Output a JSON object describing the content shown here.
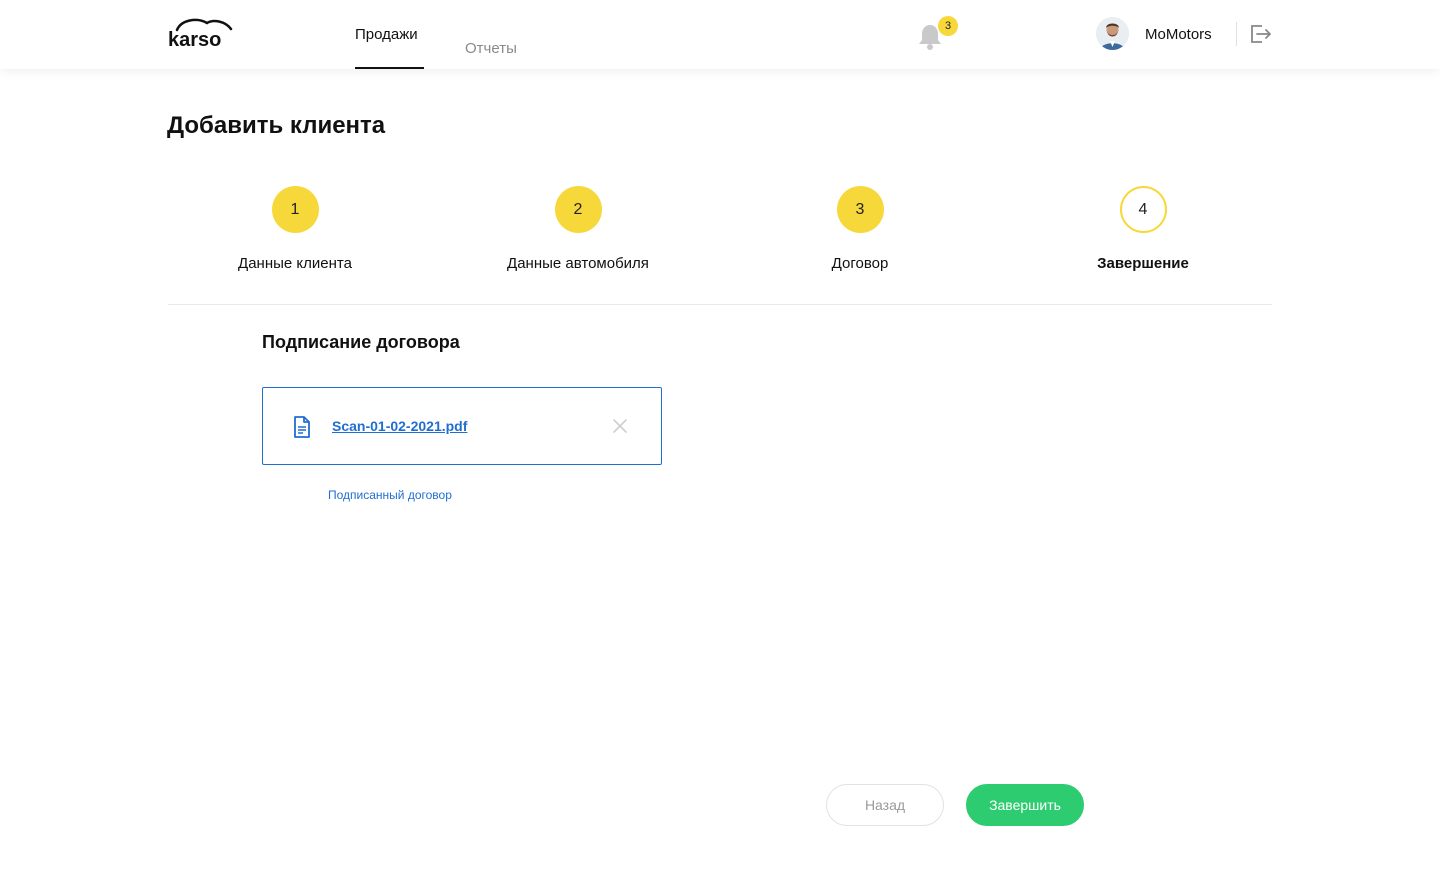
{
  "header": {
    "logo_text": "karso",
    "nav": [
      {
        "label": "Продажи",
        "active": true
      },
      {
        "label": "Отчеты",
        "active": false
      }
    ],
    "notifications_count": "3",
    "username": "MoMotors"
  },
  "page_title": "Добавить клиента",
  "steps": [
    {
      "number": "1",
      "label": "Данные клиента",
      "state": "done"
    },
    {
      "number": "2",
      "label": "Данные автомобиля",
      "state": "done"
    },
    {
      "number": "3",
      "label": "Договор",
      "state": "done"
    },
    {
      "number": "4",
      "label": "Завершение",
      "state": "current"
    }
  ],
  "section": {
    "title": "Подписание договора",
    "file_name": "Scan-01-02-2021.pdf",
    "file_caption": "Подписанный договор"
  },
  "buttons": {
    "back_label": "Назад",
    "finish_label": "Завершить"
  },
  "colors": {
    "accent_yellow": "#f7d83a",
    "link_blue": "#1f6fd1",
    "success_green": "#2ecc71"
  }
}
